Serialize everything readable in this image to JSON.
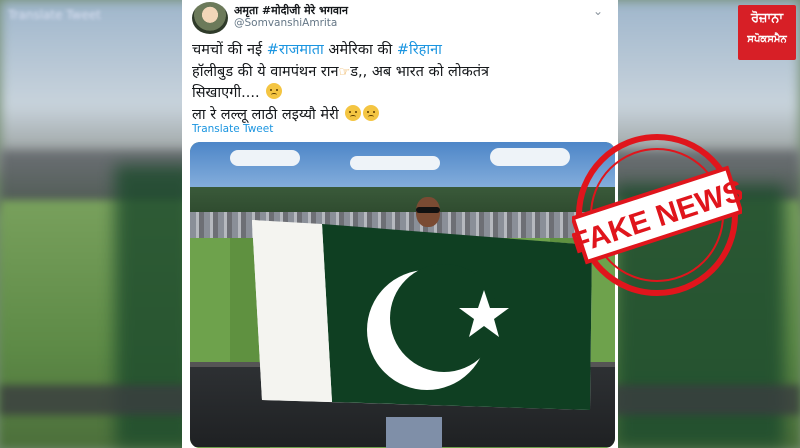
{
  "tweet": {
    "display_name": "अमृता #मोदीजी मेरे भगवान",
    "handle": "@SomvanshiAmrita",
    "line1_prefix": "चमचों की नई ",
    "line1_tag1": "#राजमाता",
    "line1_mid": " अमेरिका की ",
    "line1_tag2": "#रिहाना",
    "line2": "हॉलीबुड की ये वामपंथन रान",
    "line2_suffix": "ड,, अब भारत को लोकतंत्र",
    "line3": "सिखाएगी....",
    "line4": "ला रे लल्लू लाठी लइय्यौ मेरी",
    "translate_label": "Translate Tweet"
  },
  "stamp": {
    "text": "FAKE NEWS",
    "color": "#e0151c"
  },
  "logo": {
    "line1": "ਰੋਜ਼ਾਨਾ",
    "line2": "ਸਪੋਕਸਮੈਨ",
    "color": "#d71f26"
  },
  "background_label": "Translate Tweet",
  "icons": [
    "chevron-down-icon",
    "pointing-hand-icon",
    "smile-emoji-icon",
    "worried-emoji-icon"
  ]
}
